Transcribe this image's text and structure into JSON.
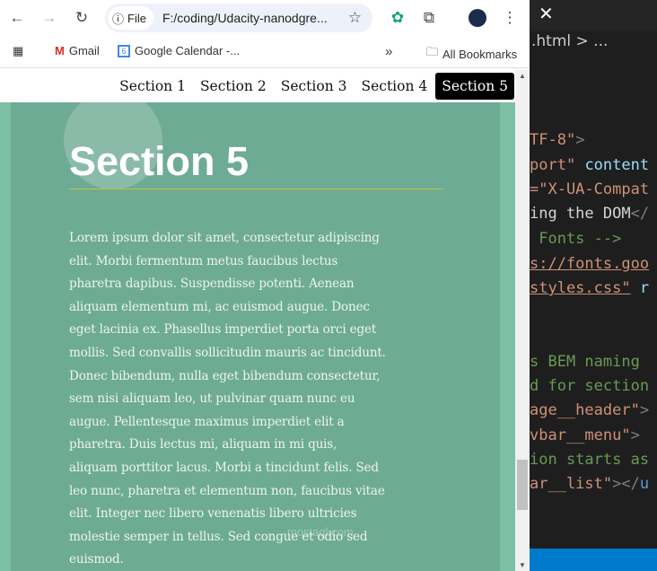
{
  "browser": {
    "chip_label": "File",
    "url": "F:/coding/Udacity-nanodgre...",
    "bookmarks": [
      {
        "label": "Gmail"
      },
      {
        "label": "Google Calendar -..."
      }
    ],
    "more": "»",
    "all_bookmarks": "All Bookmarks"
  },
  "nav": {
    "items": [
      "Section 1",
      "Section 2",
      "Section 3",
      "Section 4",
      "Section 5"
    ],
    "active": 4
  },
  "section": {
    "title": "Section 5",
    "paragraph_lines": [
      "Lorem ipsum dolor sit amet, consectetur adipiscing",
      "elit. Morbi fermentum metus faucibus lectus",
      "pharetra dapibus. Suspendisse potenti. Aenean",
      "aliquam elementum mi, ac euismod augue. Donec",
      "eget lacinia ex. Phasellus imperdiet porta orci eget",
      "mollis. Sed convallis sollicitudin mauris ac tincidunt.",
      "Donec bibendum, nulla eget bibendum consectetur,",
      "sem nisi aliquam leo, ut pulvinar quam nunc eu",
      "augue. Pellentesque maximus imperdiet elit a",
      "pharetra. Duis lectus mi, aliquam in mi quis,",
      "aliquam porttitor lacus. Morbi a tincidunt felis. Sed",
      "leo nunc, pharetra et elementum non, faucibus vitae",
      "elit. Integer nec libero venenatis libero ultricies",
      "molestie semper in tellus. Sed congue et odio sed",
      "euismod."
    ]
  },
  "watermark": "mostaql.com",
  "editor": {
    "breadcrumb": ".html > ...",
    "lines": [
      {
        "p": [
          [
            "s",
            "TF-8\""
          ],
          [
            "t",
            ">"
          ]
        ]
      },
      {
        "p": [
          [
            "s",
            "port\""
          ],
          [
            "w",
            " "
          ],
          [
            "a",
            "content"
          ]
        ]
      },
      {
        "p": [
          [
            "s",
            "=\"X-UA-Compat"
          ]
        ]
      },
      {
        "p": [
          [
            "w",
            "ing the DOM"
          ],
          [
            "t",
            "</"
          ]
        ]
      },
      {
        "p": [
          [
            "c",
            " Fonts -->"
          ]
        ]
      },
      {
        "p": [
          [
            "su",
            "s://fonts.goo"
          ]
        ]
      },
      {
        "p": [
          [
            "su",
            "styles.css\""
          ],
          [
            "w",
            " "
          ],
          [
            "a",
            "r"
          ]
        ]
      },
      {
        "p": []
      },
      {
        "p": []
      },
      {
        "p": [
          [
            "c",
            "s BEM naming"
          ]
        ]
      },
      {
        "p": [
          [
            "c",
            "d for section"
          ]
        ]
      },
      {
        "p": [
          [
            "s",
            "age__header\""
          ],
          [
            "t",
            ">"
          ]
        ]
      },
      {
        "p": [
          [
            "s",
            "vbar__menu\""
          ],
          [
            "t",
            ">"
          ]
        ]
      },
      {
        "p": [
          [
            "c",
            "ion starts as"
          ]
        ]
      },
      {
        "p": [
          [
            "s",
            "ar__list\""
          ],
          [
            "t",
            "></"
          ],
          [
            "k",
            "u"
          ]
        ]
      }
    ]
  }
}
